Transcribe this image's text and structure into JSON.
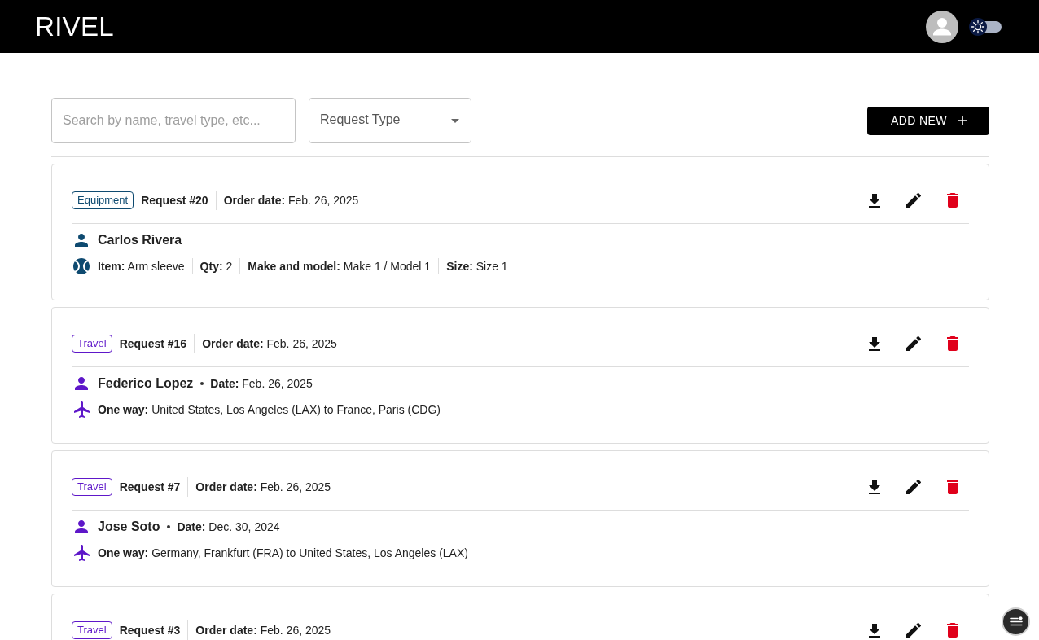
{
  "header": {
    "logo": "RIVEL",
    "theme_toggle": {
      "on": false
    }
  },
  "toolbar": {
    "search": {
      "placeholder": "Search by name, travel type, etc..."
    },
    "request_type": {
      "label": "Request Type"
    },
    "add_button": "ADD NEW"
  },
  "requests": [
    {
      "kind": "equipment",
      "type": "Equipment",
      "color": "#0e4a70",
      "number": "Request #20",
      "order_date": "**Order date:** Feb. 26, 2025",
      "name": "Carlos Rivera",
      "details": [
        "**Item:** Arm sleeve",
        "**Qty:** 2",
        "**Make and model:** Make 1 / Model 1",
        "**Size:** Size 1"
      ]
    },
    {
      "kind": "travel",
      "type": "Travel",
      "color": "#5e17c9",
      "number": "Request #16",
      "order_date": "**Order date:** Feb. 26, 2025",
      "name": "Federico Lopez",
      "date": "**Date:** Feb. 26, 2025",
      "details": [
        "**One way:** United States, Los Angeles (LAX) to France, Paris (CDG)"
      ]
    },
    {
      "kind": "travel",
      "type": "Travel",
      "color": "#5e17c9",
      "number": "Request #7",
      "order_date": "**Order date:** Feb. 26, 2025",
      "name": "Jose Soto",
      "date": "**Date:** Dec. 30, 2024",
      "details": [
        "**One way:** Germany, Frankfurt (FRA) to United States, Los Angeles (LAX)"
      ]
    },
    {
      "type": "Travel",
      "color": "#5e17c9",
      "number": "Request #3",
      "order_date": "**Order date:** Feb. 26, 2025"
    }
  ]
}
